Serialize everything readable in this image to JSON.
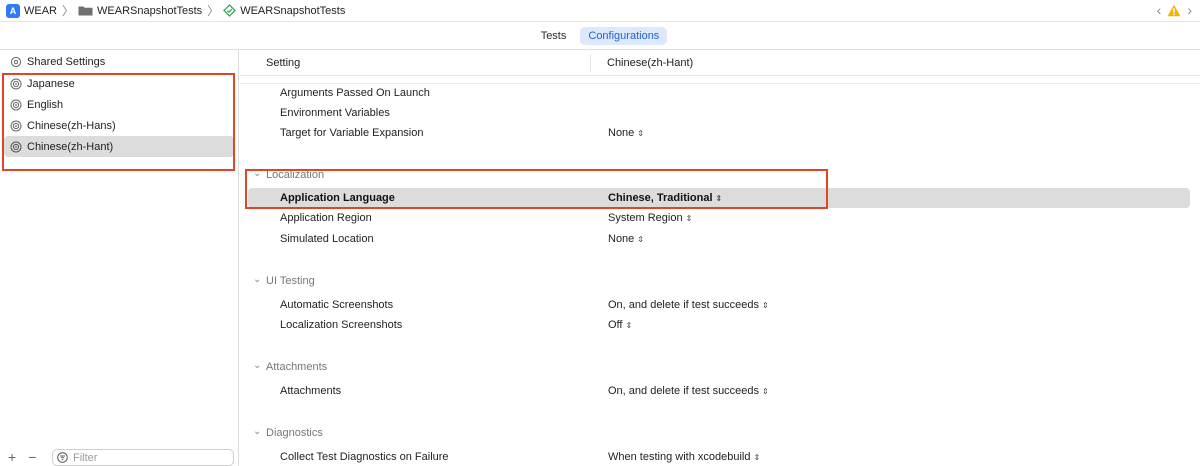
{
  "breadcrumb": {
    "project": "WEAR",
    "folder": "WEARSnapshotTests",
    "target": "WEARSnapshotTests"
  },
  "tabs": [
    {
      "label": "Tests",
      "active": false
    },
    {
      "label": "Configurations",
      "active": true
    }
  ],
  "sidebar": {
    "items": [
      {
        "label": "Shared Settings",
        "icon": "gear-icon"
      },
      {
        "label": "Japanese",
        "icon": "scheme-icon"
      },
      {
        "label": "English",
        "icon": "scheme-icon"
      },
      {
        "label": "Chinese(zh-Hans)",
        "icon": "scheme-icon"
      },
      {
        "label": "Chinese(zh-Hant)",
        "icon": "scheme-icon",
        "selected": true
      }
    ],
    "add_label": "+",
    "remove_label": "−",
    "filter_placeholder": "Filter"
  },
  "table": {
    "header_setting": "Setting",
    "header_value": "Chinese(zh-Hant)",
    "rows_general": [
      {
        "key": "Arguments Passed On Launch",
        "value": ""
      },
      {
        "key": "Environment Variables",
        "value": ""
      },
      {
        "key": "Target for Variable Expansion",
        "value": "None"
      }
    ],
    "sections": [
      {
        "title": "Localization",
        "rows": [
          {
            "key": "Application Language",
            "value": "Chinese, Traditional",
            "selected": true
          },
          {
            "key": "Application Region",
            "value": "System Region"
          },
          {
            "key": "Simulated Location",
            "value": "None"
          }
        ]
      },
      {
        "title": "UI Testing",
        "rows": [
          {
            "key": "Automatic Screenshots",
            "value": "On, and delete if test succeeds"
          },
          {
            "key": "Localization Screenshots",
            "value": "Off"
          }
        ]
      },
      {
        "title": "Attachments",
        "rows": [
          {
            "key": "Attachments",
            "value": "On, and delete if test succeeds"
          }
        ]
      },
      {
        "title": "Diagnostics",
        "rows": [
          {
            "key": "Collect Test Diagnostics on Failure",
            "value": "When testing with xcodebuild"
          }
        ]
      }
    ]
  },
  "colors": {
    "accent": "#1f63d6",
    "tab_active_bg": "#dce8fb",
    "selection": "#dcdcdc",
    "annotation_red": "#e0442b"
  }
}
